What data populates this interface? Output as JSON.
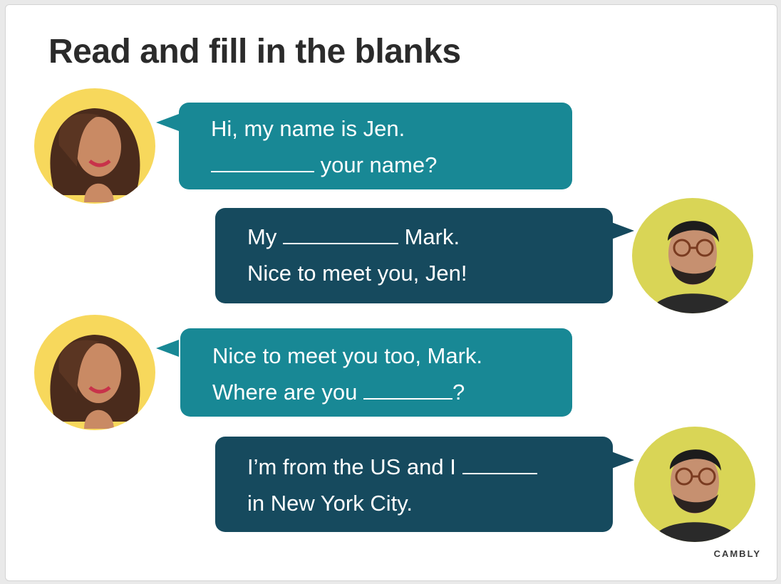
{
  "title": "Read and fill in the blanks",
  "brand": "CAMBLY",
  "colors": {
    "jen_bubble": "#188895",
    "mark_bubble": "#164a5e",
    "jen_avatar_bg": "#f7d85c",
    "mark_avatar_bg": "#d9d556"
  },
  "dialogue": [
    {
      "speaker_icon": "woman-avatar-icon",
      "lines": [
        "Hi, my name is Jen.",
        "your name?"
      ]
    },
    {
      "speaker_icon": "man-avatar-icon",
      "lines": [
        "My",
        "Mark.",
        "Nice to meet you, Jen!"
      ]
    },
    {
      "speaker_icon": "woman-avatar-icon",
      "lines": [
        "Nice to meet you too, Mark.",
        "Where are you",
        "?"
      ]
    },
    {
      "speaker_icon": "man-avatar-icon",
      "lines": [
        "I’m from the US and I",
        "in New York City."
      ]
    }
  ]
}
